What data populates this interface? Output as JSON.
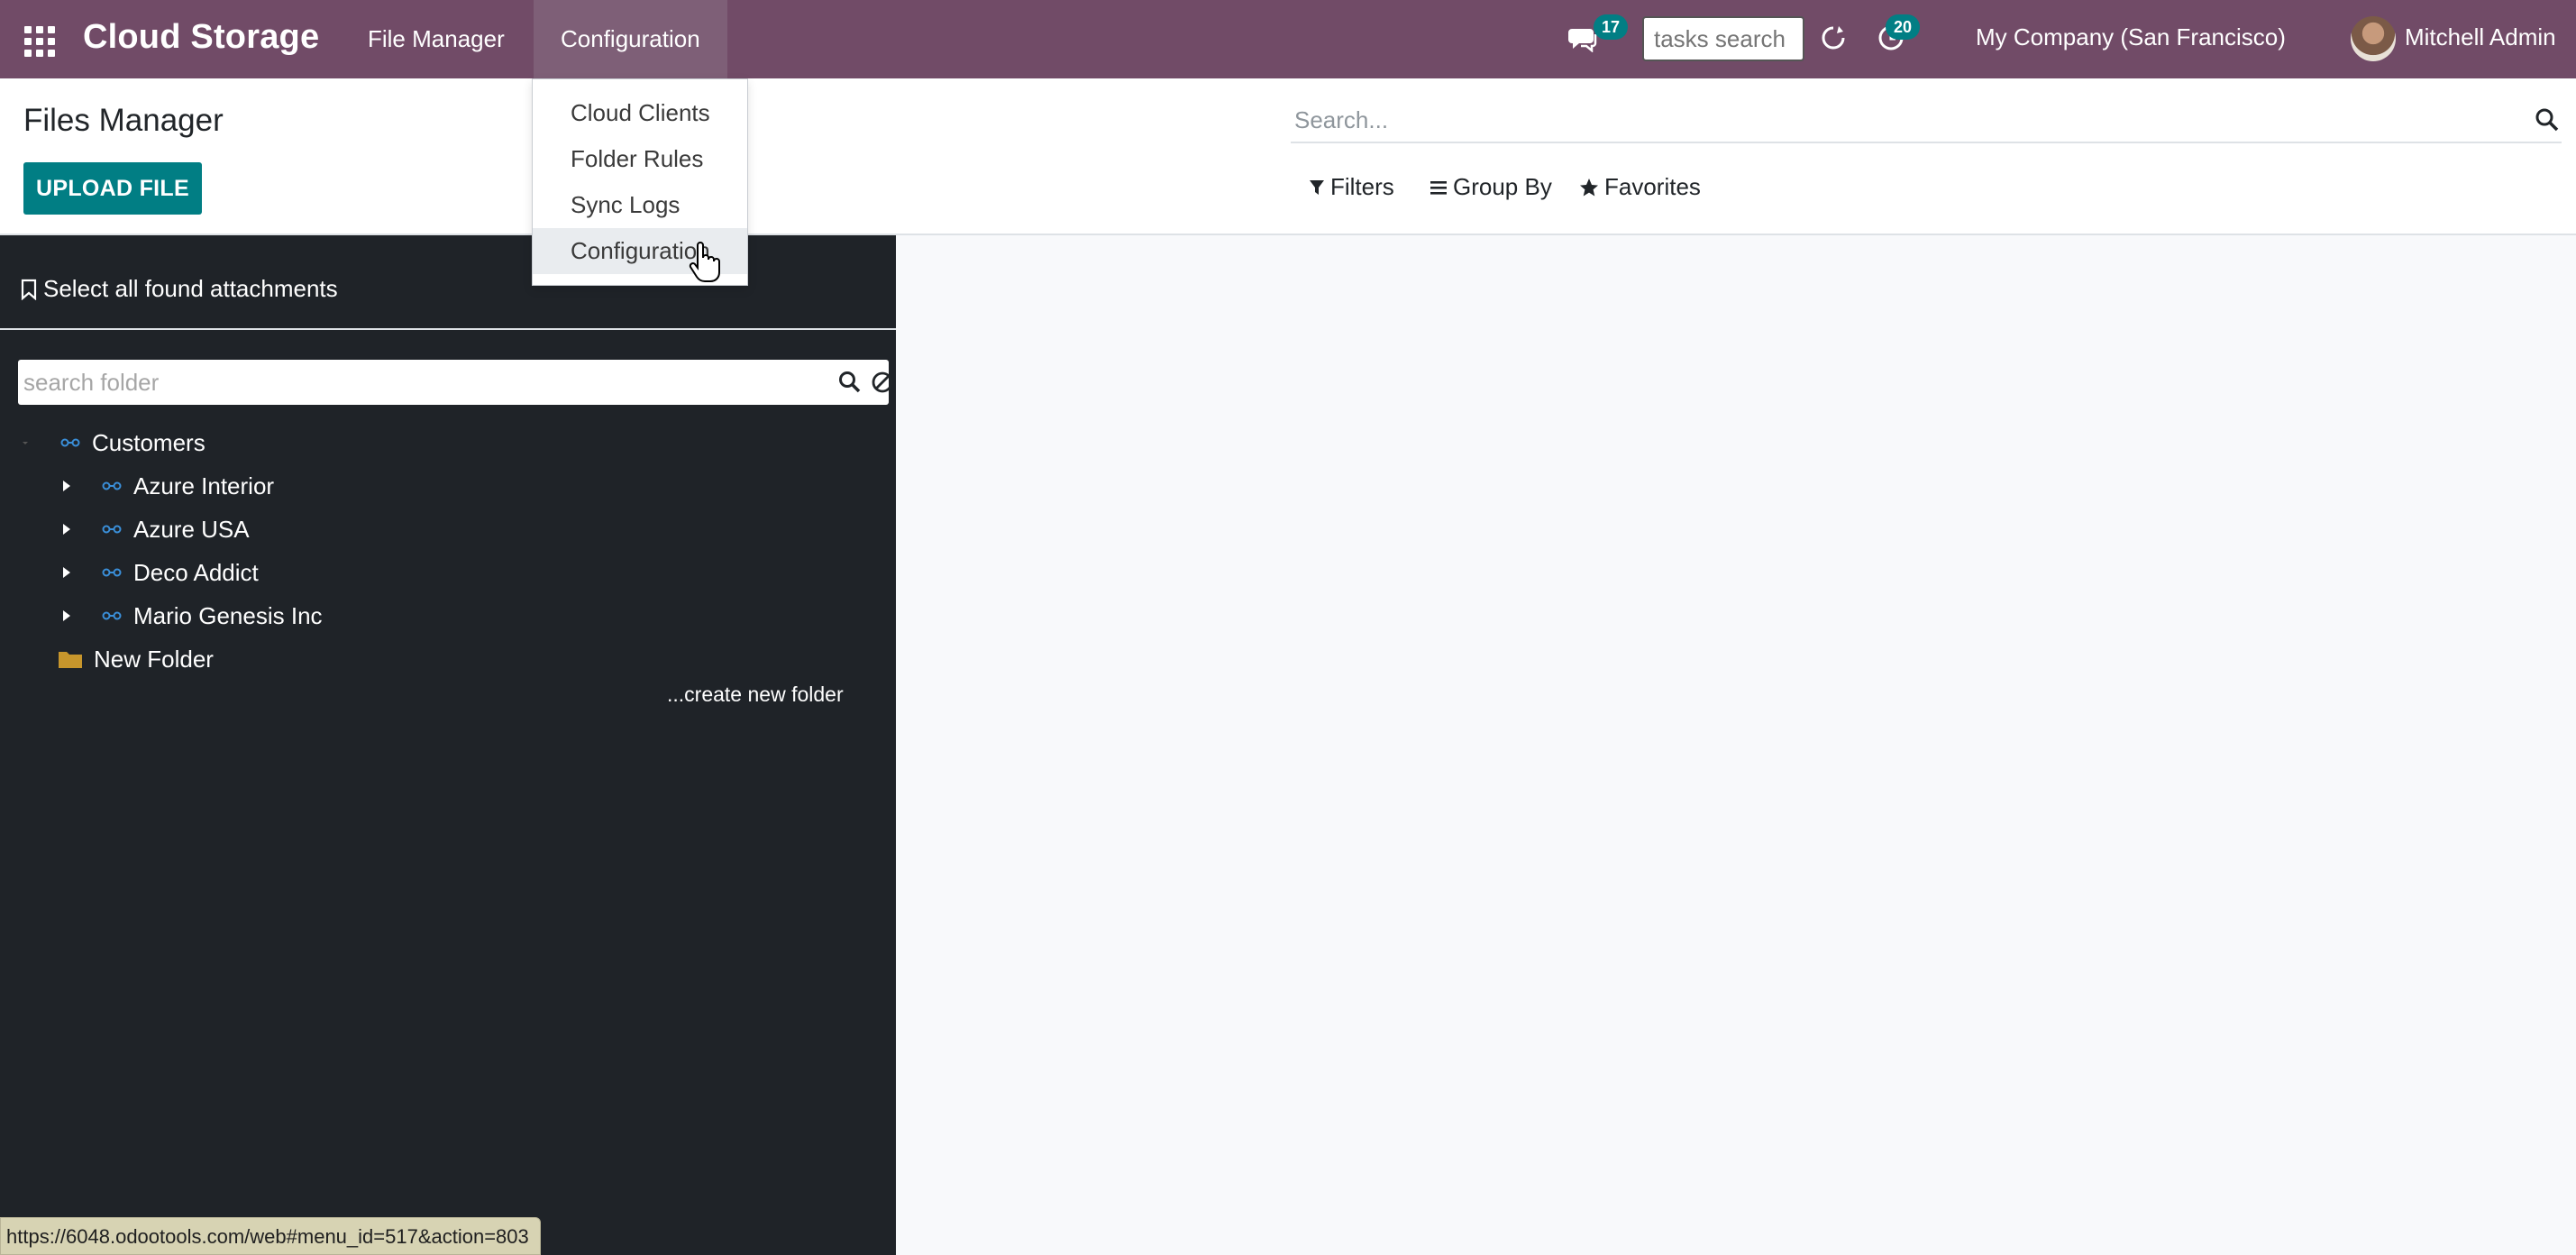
{
  "navbar": {
    "app_title": "Cloud Storage",
    "menus": [
      "File Manager",
      "Configuration"
    ],
    "chat_count": "17",
    "tasks_search_placeholder": "tasks search",
    "activity_count": "20",
    "company": "My Company (San Francisco)",
    "user": "Mitchell Admin",
    "brand_color": "#714b67"
  },
  "control_panel": {
    "title": "Files Manager",
    "upload_label": "UPLOAD FILE",
    "search_placeholder": "Search...",
    "filters_label": "Filters",
    "groupby_label": "Group By",
    "favorites_label": "Favorites",
    "accent_color": "#017e84"
  },
  "sidebar": {
    "select_all_label": "Select all found attachments",
    "folder_search_placeholder": "search folder",
    "tree": [
      {
        "label": "Customers",
        "level": 0,
        "icon": "link-icon",
        "expanded": true
      },
      {
        "label": "Azure Interior",
        "level": 1,
        "icon": "link-icon",
        "expanded": false
      },
      {
        "label": "Azure USA",
        "level": 1,
        "icon": "link-icon",
        "expanded": false
      },
      {
        "label": "Deco Addict",
        "level": 1,
        "icon": "link-icon",
        "expanded": false
      },
      {
        "label": "Mario Genesis Inc",
        "level": 1,
        "icon": "link-icon",
        "expanded": false
      },
      {
        "label": "New Folder",
        "level": 0,
        "icon": "folder-icon",
        "expanded": false
      }
    ],
    "create_folder_label": "...create new folder"
  },
  "dropdown": {
    "items": [
      "Cloud Clients",
      "Folder Rules",
      "Sync Logs",
      "Configuration"
    ],
    "hovered_item": "Configuration"
  },
  "status_bar": {
    "url": "https://6048.odootools.com/web#menu_id=517&action=803"
  }
}
